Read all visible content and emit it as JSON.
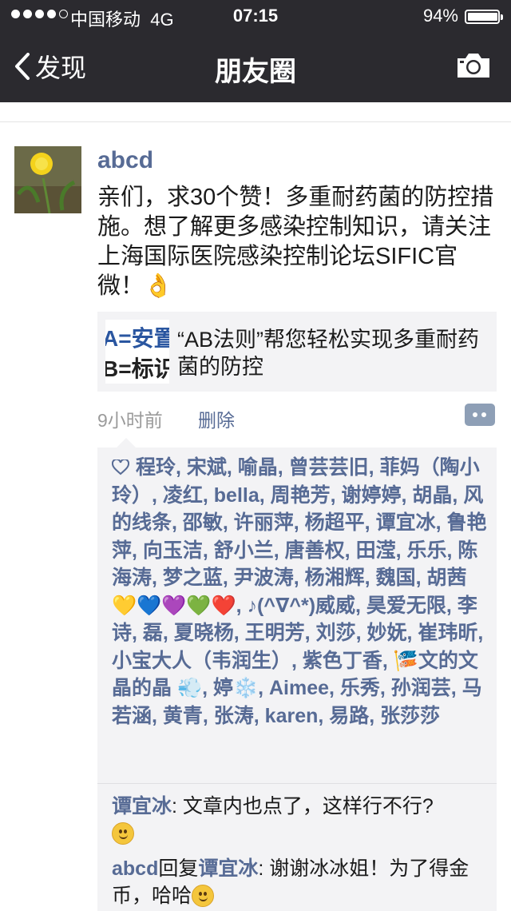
{
  "status": {
    "carrier": "中国移动",
    "network": "4G",
    "time": "07:15",
    "battery": "94%",
    "battery_level": 0.94,
    "signal_bars": 4
  },
  "nav": {
    "back_label": "发现",
    "title": "朋友圈"
  },
  "post": {
    "author": "abcd",
    "text": "亲们，求30个赞！多重耐药菌的防控措施。想了解更多感染控制知识，请关注上海国际医院感染控制论坛SIFIC官微！👌",
    "link": {
      "thumb_line1": "A=安置",
      "thumb_line2": "B=标识",
      "title": "“AB法则”帮您轻松实现多重耐药菌的防控"
    },
    "time": "9小时前",
    "delete_label": "删除",
    "likes": "程玲, 宋斌, 喻晶, 曾芸芸旧, 菲妈（陶小玲）, 凌红, bella, 周艳芳, 谢婷婷, 胡晶, 风的线条, 邵敏, 许丽萍, 杨超平, 谭宜冰, 鲁艳萍, 向玉洁, 舒小兰, 唐善权, 田滢, 乐乐, 陈海涛, 梦之蓝, 尹波涛, 杨湘辉, 魏国, 胡茜💛💙💜💚❤️, ♪(^∇^*)威威, 昊爱无限, 李诗, 磊, 夏晓杨, 王明芳, 刘莎, 妙妩, 崔玮昕, 小宝大人（韦润生）, 紫色丁香, 🎏文的文 晶的晶 💨, 婷❄️, Aimee, 乐秀, 孙润芸, 马若涵, 黄青, 张涛, karen, 易路, 张莎莎",
    "comments": [
      {
        "name": "谭宜冰",
        "text": ": 文章内也点了，这样行不行?",
        "emoji": "smile"
      },
      {
        "name": "abcd",
        "reply_word": "回复",
        "reply_to": "谭宜冰",
        "text": ": 谢谢冰冰姐！为了得金币，哈哈",
        "emoji": "grin"
      }
    ]
  },
  "colors": {
    "nav_bg": "#2b2a2f",
    "link_blue": "#576b95",
    "panel_bg": "#f3f3f5"
  }
}
